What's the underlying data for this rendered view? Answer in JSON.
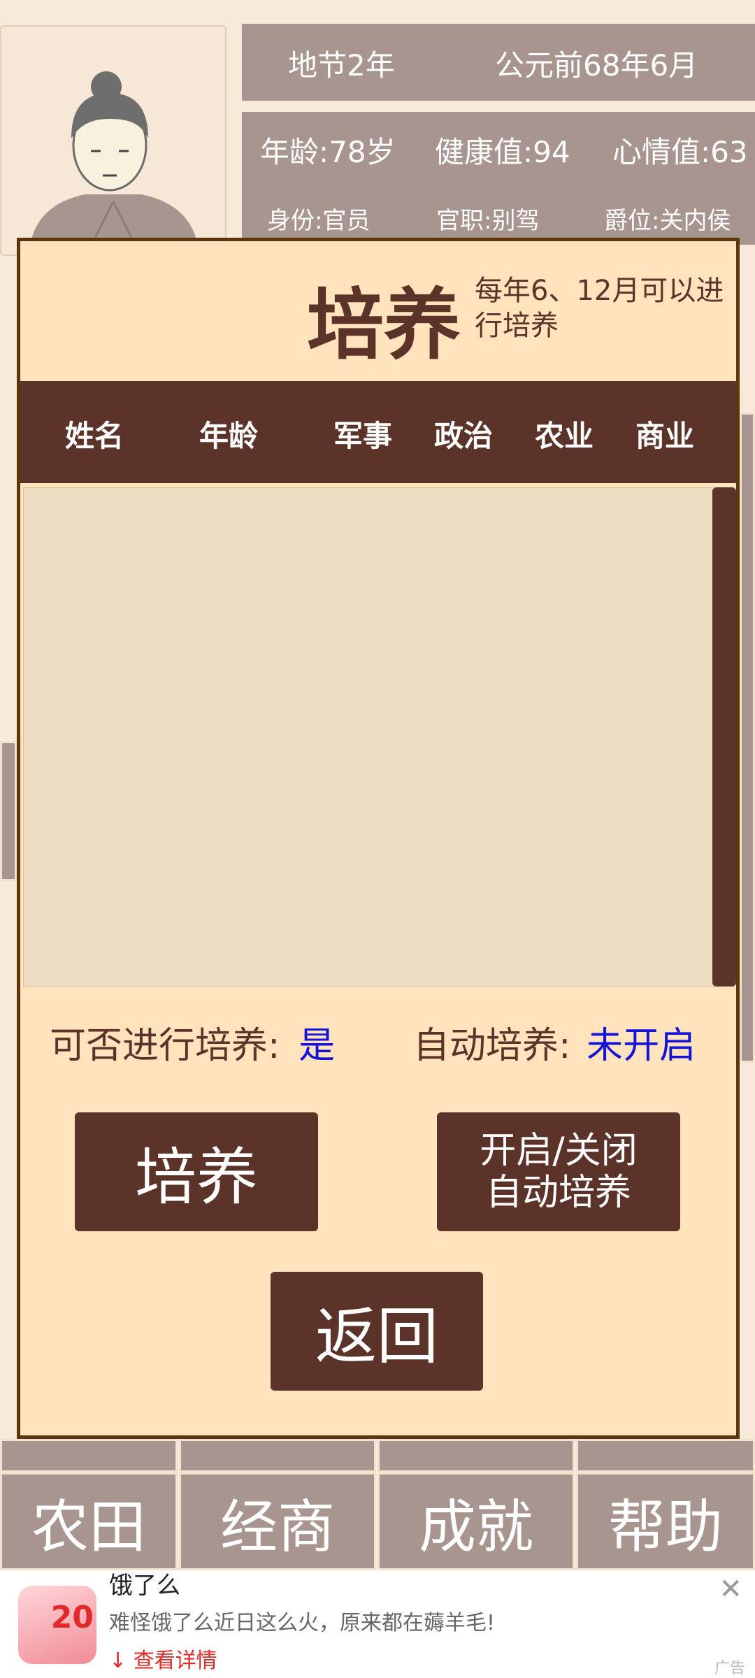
{
  "top": {
    "year_label": "地节2年",
    "date_label": "公元前68年6月"
  },
  "stats": {
    "age": "年龄:78岁",
    "health": "健康值:94",
    "mood": "心情值:63",
    "identity": "身份:官员",
    "office": "官职:别驾",
    "rank": "爵位:关内侯"
  },
  "modal": {
    "title": "培养",
    "hint": "每年6、12月可以进行培养",
    "columns": [
      "姓名",
      "年龄",
      "军事",
      "政治",
      "农业",
      "商业"
    ],
    "can_train_label": "可否进行培养:",
    "can_train_value": "是",
    "auto_label": "自动培养:",
    "auto_value": "未开启",
    "train_button": "培养",
    "toggle_auto_line1": "开启/关闭",
    "toggle_auto_line2": "自动培养",
    "back_button": "返回"
  },
  "bottom_nav": [
    "农田",
    "经商",
    "成就",
    "帮助"
  ],
  "ad": {
    "title": "饿了么",
    "desc": "难怪饿了么近日这么火，原来都在薅羊毛!",
    "link": "查看详情",
    "thumb_number": "20",
    "tag": "广告",
    "close_icon": "close-icon"
  },
  "colors": {
    "brown": "#5c3328",
    "panel": "#a89590",
    "modal_bg": "#ffe3bd",
    "value_blue": "#1414d8"
  }
}
